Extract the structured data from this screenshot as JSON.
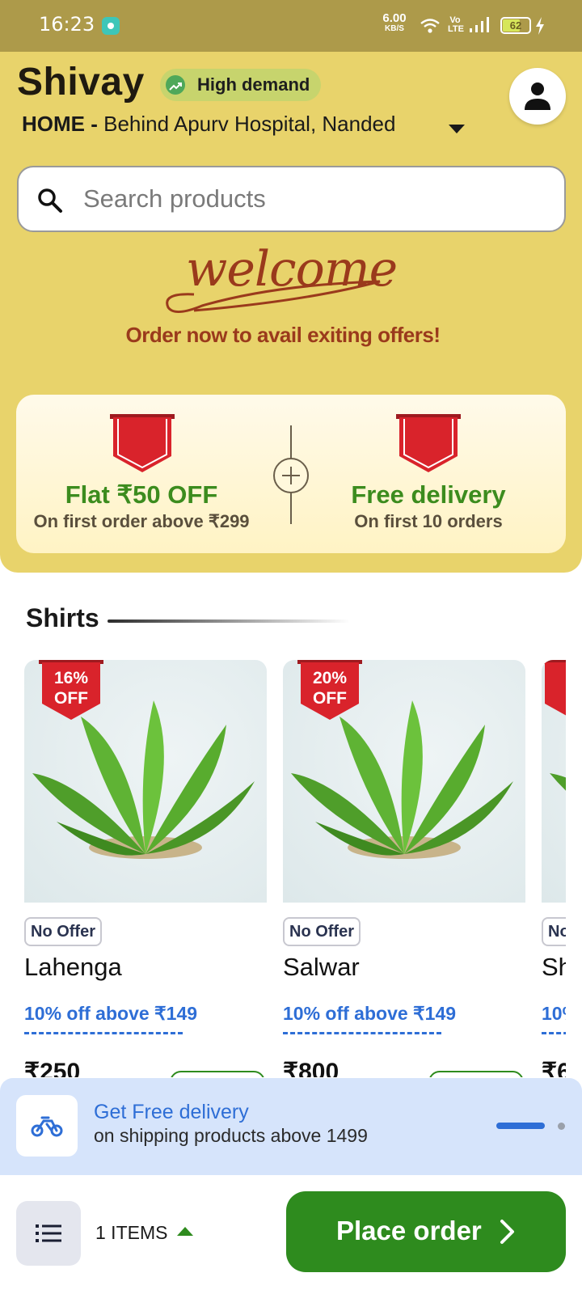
{
  "status_bar": {
    "time": "16:23",
    "speed_value": "6.00",
    "speed_unit": "KB/S",
    "volte": "Vo LTE",
    "battery": "62",
    "battery_level": 0.62
  },
  "header": {
    "store_name": "Shivay",
    "demand_badge": "High demand",
    "address_label": "HOME -",
    "address": "Behind Apurv Hospital, Nanded"
  },
  "search": {
    "placeholder": "Search products"
  },
  "welcome": {
    "word": "welcome",
    "subtitle": "Order now to avail exiting offers!"
  },
  "offers": [
    {
      "title": "Flat ₹50 OFF",
      "subtitle": "On first order above ₹299"
    },
    {
      "title": "Free delivery",
      "subtitle": "On first 10 orders"
    }
  ],
  "section": {
    "title": "Shirts"
  },
  "products": [
    {
      "discount": "16%",
      "discount_label": "OFF",
      "offer_tag": "No Offer",
      "name": "Lahenga",
      "deal": "10% off above ₹149",
      "price": "₹250"
    },
    {
      "discount": "20%",
      "discount_label": "OFF",
      "offer_tag": "No Offer",
      "name": "Salwar",
      "deal": "10% off above ₹149",
      "price": "₹800"
    },
    {
      "discount": "",
      "discount_label": "",
      "offer_tag": "No",
      "name": "Sh",
      "deal": "10%",
      "price": "₹6"
    }
  ],
  "delivery_banner": {
    "title": "Get Free delivery",
    "subtitle": "on shipping products above 1499"
  },
  "bottom_bar": {
    "items_label": "1 ITEMS",
    "place_order_label": "Place order"
  },
  "colors": {
    "header_bg": "#e8d36b",
    "status_bar_bg": "#ad9a4a",
    "primary_green": "#2e8b1e",
    "accent_blue": "#2e6ed6",
    "ribbon_red": "#d9232b",
    "brand_brown": "#9a3a1c"
  },
  "icons": [
    "search-icon",
    "user-icon",
    "trend-up-icon",
    "chevron-down-icon",
    "plus-icon",
    "bike-icon",
    "list-icon",
    "chevron-right-icon",
    "wifi-icon",
    "signal-icon",
    "battery-icon"
  ]
}
